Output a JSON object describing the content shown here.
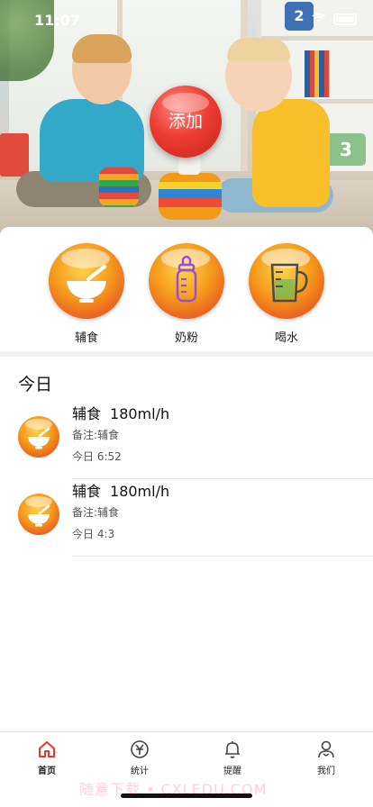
{
  "status_bar": {
    "time": "11:07"
  },
  "hero": {
    "add_button_label": "添加",
    "toy_box_text": "2",
    "toy_box2_text": "3",
    "carousel": {
      "count": 3,
      "active_index": 1
    }
  },
  "categories": [
    {
      "label": "辅食",
      "icon": "bowl-icon"
    },
    {
      "label": "奶粉",
      "icon": "baby-bottle-icon"
    },
    {
      "label": "喝水",
      "icon": "water-cup-icon"
    }
  ],
  "today": {
    "title": "今日",
    "records": [
      {
        "type": "辅食",
        "amount": "180ml/h",
        "note": "备注:辅食",
        "time": "今日 6:52",
        "icon": "bowl-icon"
      },
      {
        "type": "辅食",
        "amount": "180ml/h",
        "note": "备注:辅食",
        "time": "今日 4:3",
        "icon": "bowl-icon"
      }
    ]
  },
  "tabbar": {
    "items": [
      {
        "label": "首页",
        "icon": "home-icon",
        "active": true
      },
      {
        "label": "统计",
        "icon": "stats-icon",
        "active": false
      },
      {
        "label": "提醒",
        "icon": "bell-icon",
        "active": false
      },
      {
        "label": "我们",
        "icon": "user-icon",
        "active": false
      }
    ],
    "active_color": "#e8382c"
  },
  "watermark": "随意下载 • CXLEDU.COM",
  "colors": {
    "accent": "#e8382c",
    "orb_light": "#ffd24a",
    "orb_dark": "#e2351f"
  }
}
